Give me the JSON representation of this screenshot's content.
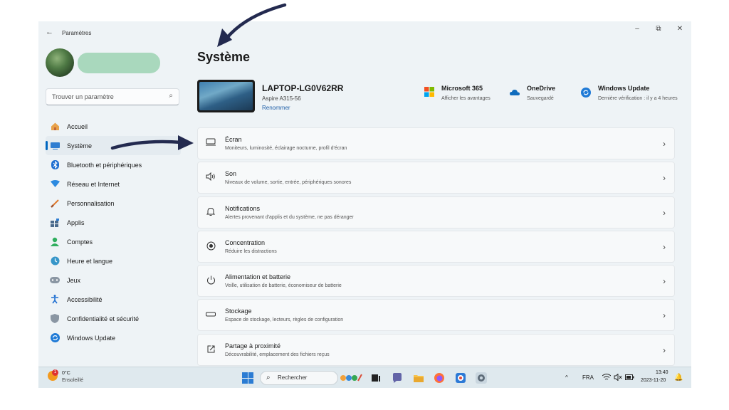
{
  "window": {
    "app_title": "Paramètres",
    "back_glyph": "←",
    "minimize_glyph": "–",
    "maximize_glyph": "⧉",
    "close_glyph": "✕"
  },
  "search": {
    "placeholder": "Trouver un paramètre",
    "icon": "search-icon"
  },
  "sidebar": {
    "items": [
      {
        "label": "Accueil",
        "icon": "home-icon",
        "glyph": "🏠"
      },
      {
        "label": "Système",
        "icon": "system-icon",
        "glyph": "▬",
        "active": true
      },
      {
        "label": "Bluetooth et périphériques",
        "icon": "bluetooth-icon",
        "glyph": "ᛒ"
      },
      {
        "label": "Réseau et Internet",
        "icon": "wifi-icon",
        "glyph": "▼"
      },
      {
        "label": "Personnalisation",
        "icon": "brush-icon",
        "glyph": "/"
      },
      {
        "label": "Applis",
        "icon": "apps-icon",
        "glyph": "▦"
      },
      {
        "label": "Comptes",
        "icon": "account-icon",
        "glyph": "●"
      },
      {
        "label": "Heure et langue",
        "icon": "clock-globe-icon",
        "glyph": "◔"
      },
      {
        "label": "Jeux",
        "icon": "gamepad-icon",
        "glyph": "◎"
      },
      {
        "label": "Accessibilité",
        "icon": "accessibility-icon",
        "glyph": "✗"
      },
      {
        "label": "Confidentialité et sécurité",
        "icon": "shield-icon",
        "glyph": "⛉"
      },
      {
        "label": "Windows Update",
        "icon": "update-icon",
        "glyph": "⟳"
      }
    ]
  },
  "main": {
    "title": "Système",
    "device": {
      "name": "LAPTOP-LG0V62RR",
      "model": "Aspire A315-56",
      "rename": "Renommer"
    },
    "status": [
      {
        "title": "Microsoft 365",
        "sub": "Afficher les avantages",
        "icon": "microsoft-365-icon"
      },
      {
        "title": "OneDrive",
        "sub": "Sauvegardé",
        "icon": "onedrive-icon"
      },
      {
        "title": "Windows Update",
        "sub": "Dernière vérification : il y a 4 heures",
        "icon": "windows-update-icon"
      }
    ],
    "cards": [
      {
        "title": "Écran",
        "sub": "Moniteurs, luminosité, éclairage nocturne, profil d'écran",
        "icon": "display-icon",
        "glyph": "▭"
      },
      {
        "title": "Son",
        "sub": "Niveaux de volume, sortie, entrée, périphériques sonores",
        "icon": "speaker-icon",
        "glyph": "🔈"
      },
      {
        "title": "Notifications",
        "sub": "Alertes provenant d'applis et du système, ne pas déranger",
        "icon": "bell-icon",
        "glyph": "🔔"
      },
      {
        "title": "Concentration",
        "sub": "Réduire les distractions",
        "icon": "focus-icon",
        "glyph": "◉"
      },
      {
        "title": "Alimentation et batterie",
        "sub": "Veille, utilisation de batterie, économiseur de batterie",
        "icon": "power-icon",
        "glyph": "⏻"
      },
      {
        "title": "Stockage",
        "sub": "Espace de stockage, lecteurs, règles de configuration",
        "icon": "storage-icon",
        "glyph": "▭"
      },
      {
        "title": "Partage à proximité",
        "sub": "Découvrabilité, emplacement des fichiers reçus",
        "icon": "share-icon",
        "glyph": "⇗"
      }
    ],
    "chevron": "›"
  },
  "taskbar": {
    "weather_temp": "0°C",
    "weather_desc": "Ensoleillé",
    "weather_badge": "1",
    "search_label": "Rechercher",
    "language": "FRA",
    "time": "13:40",
    "date": "2023-11-20",
    "tray_chevron": "^"
  }
}
